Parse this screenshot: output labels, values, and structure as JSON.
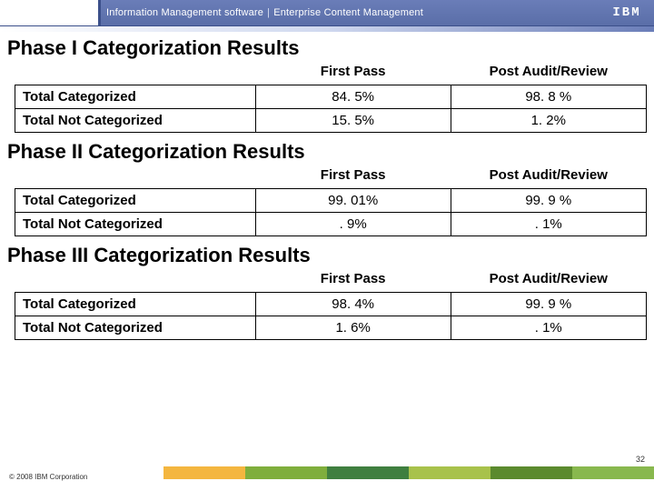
{
  "header": {
    "crumb1": "Information Management software",
    "crumb2": "Enterprise Content Management",
    "logo": "IBM"
  },
  "sections": [
    {
      "title": "Phase I Categorization Results",
      "col1": "First Pass",
      "col2": "Post Audit/Review",
      "rows": [
        {
          "label": "Total Categorized",
          "v1": "84. 5%",
          "v2": "98. 8 %"
        },
        {
          "label": "Total Not Categorized",
          "v1": "15. 5%",
          "v2": "1. 2%"
        }
      ]
    },
    {
      "title": "Phase II Categorization Results",
      "col1": "First Pass",
      "col2": "Post Audit/Review",
      "rows": [
        {
          "label": "Total Categorized",
          "v1": "99. 01%",
          "v2": "99. 9 %"
        },
        {
          "label": "Total Not Categorized",
          "v1": ". 9%",
          "v2": ". 1%"
        }
      ]
    },
    {
      "title": "Phase III Categorization Results",
      "col1": "First Pass",
      "col2": "Post Audit/Review",
      "rows": [
        {
          "label": "Total Categorized",
          "v1": "98. 4%",
          "v2": "99. 9 %"
        },
        {
          "label": "Total Not Categorized",
          "v1": "1. 6%",
          "v2": ". 1%"
        }
      ]
    }
  ],
  "page_number": "32",
  "copyright": "© 2008 IBM Corporation"
}
